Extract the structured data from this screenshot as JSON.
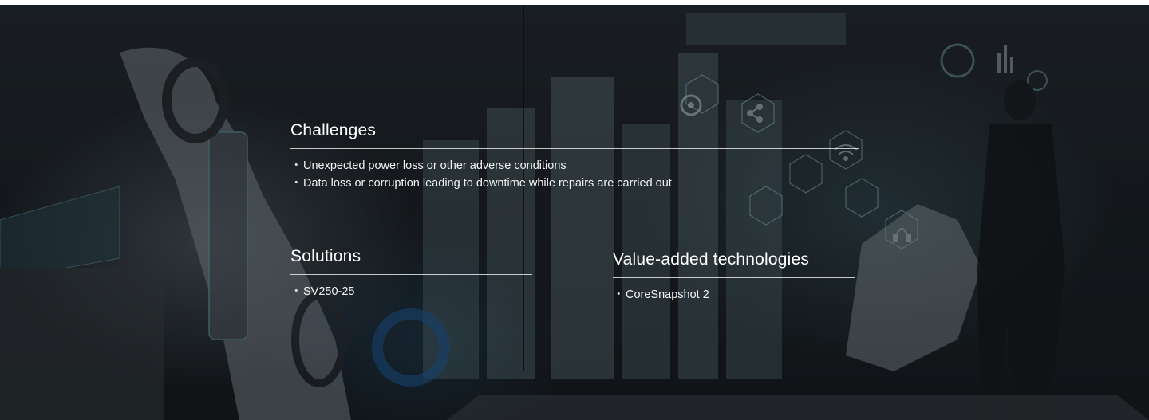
{
  "challenges": {
    "title": "Challenges",
    "items": [
      "Unexpected power loss or other adverse conditions",
      "Data loss or corruption leading to downtime while repairs are carried out"
    ]
  },
  "solutions": {
    "title": "Solutions",
    "items": [
      "SV250-25"
    ]
  },
  "value_added": {
    "title": "Value-added technologies",
    "items": [
      "CoreSnapshot 2"
    ]
  },
  "bullet": "・",
  "colors": {
    "text": "#ffffff",
    "rule": "#e6e6e6",
    "background": "#1b2024",
    "accent_teal": "#5fa7b0"
  },
  "icons": [
    "gear-icon",
    "share-icon",
    "wifi-icon",
    "headset-icon"
  ]
}
